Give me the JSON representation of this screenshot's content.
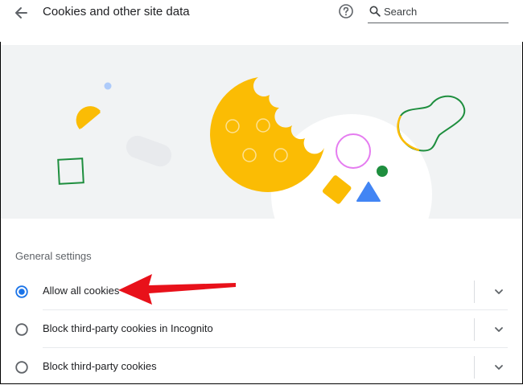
{
  "header": {
    "title": "Cookies and other site data",
    "back_icon": "arrow-back-icon",
    "help_icon": "help-icon",
    "search": {
      "placeholder": "Search",
      "value": "",
      "icon": "search-icon"
    }
  },
  "banner": {
    "illustration": "cookie-illustration"
  },
  "general_settings": {
    "title": "General settings",
    "options": [
      {
        "label": "Allow all cookies",
        "selected": true
      },
      {
        "label": "Block third-party cookies in Incognito",
        "selected": false
      },
      {
        "label": "Block third-party cookies",
        "selected": false
      }
    ]
  },
  "annotation": {
    "type": "red-arrow",
    "color": "#e8111a"
  },
  "colors": {
    "accent": "#1a73e8",
    "cookie": "#fbbc04",
    "green": "#1e8e3e",
    "blue": "#4285f4",
    "pink": "#e57cf0"
  }
}
